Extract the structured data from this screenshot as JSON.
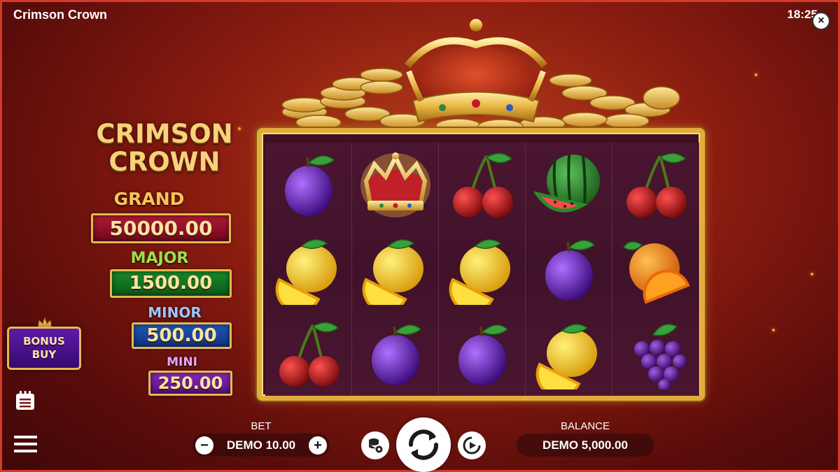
{
  "app": {
    "title": "Crimson Crown",
    "clock": "18:25",
    "close_icon": "×"
  },
  "logo": {
    "line1": "CRIMSON",
    "line2": "CROWN"
  },
  "jackpots": {
    "grand": {
      "label": "GRAND",
      "value": "50000.00",
      "color": "#b01a36"
    },
    "major": {
      "label": "MAJOR",
      "value": "1500.00",
      "color": "#188a2a"
    },
    "minor": {
      "label": "MINOR",
      "value": "500.00",
      "color": "#1f58b8"
    },
    "mini": {
      "label": "MINI",
      "value": "250.00",
      "color": "#8a2ab8"
    }
  },
  "bonus_buy": {
    "line1": "BONUS",
    "line2": "BUY"
  },
  "reels": [
    [
      "plum",
      "lemon",
      "cherry"
    ],
    [
      "crown",
      "lemon",
      "plum"
    ],
    [
      "cherry",
      "lemon",
      "plum"
    ],
    [
      "watermelon",
      "plum",
      "lemon"
    ],
    [
      "cherry",
      "orange",
      "grapes"
    ]
  ],
  "controls": {
    "bet_label": "BET",
    "bet_value": "DEMO 10.00",
    "minus": "−",
    "plus": "+",
    "balance_label": "BALANCE",
    "balance_value": "DEMO 5,000.00"
  },
  "icons": [
    "paytable-icon",
    "menu-icon",
    "settings-coins-icon",
    "spin-icon",
    "autoplay-icon",
    "close-icon"
  ]
}
